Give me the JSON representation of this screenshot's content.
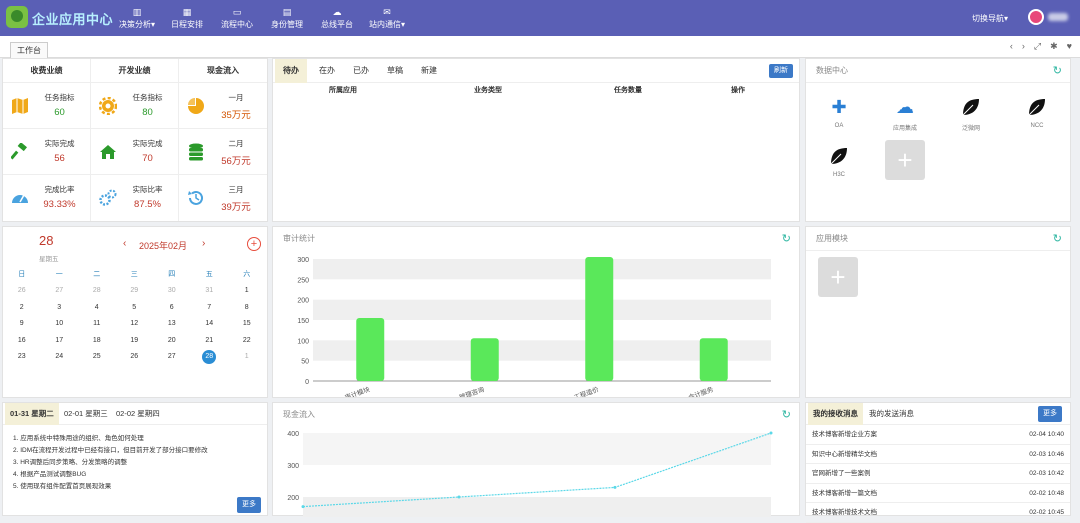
{
  "header": {
    "app_title": "企业应用中心",
    "nav": [
      {
        "label": "决策分析",
        "icon": "bar-chart-icon",
        "dropdown": true
      },
      {
        "label": "日程安排",
        "icon": "calendar-icon",
        "dropdown": false
      },
      {
        "label": "流程中心",
        "icon": "monitor-icon",
        "dropdown": false
      },
      {
        "label": "身份管理",
        "icon": "id-card-icon",
        "dropdown": false
      },
      {
        "label": "总线平台",
        "icon": "cloud-icon",
        "dropdown": false
      },
      {
        "label": "站内通信",
        "icon": "mail-icon",
        "dropdown": true
      }
    ],
    "switch_nav": "切换导航"
  },
  "tabbar": {
    "active_tab": "工作台"
  },
  "stats": {
    "headers": [
      "收费业绩",
      "开发业绩",
      "现金流入"
    ],
    "rows": [
      [
        {
          "label": "任务指标",
          "value": "60",
          "color": "g",
          "icon": "map-icon"
        },
        {
          "label": "任务指标",
          "value": "80",
          "color": "g",
          "icon": "gear-icon"
        },
        {
          "label": "一月",
          "value": "35万元",
          "color": "r",
          "icon": "pie-chart-icon"
        }
      ],
      [
        {
          "label": "实际完成",
          "value": "56",
          "color": "r",
          "icon": "gavel-icon"
        },
        {
          "label": "实际完成",
          "value": "70",
          "color": "r",
          "icon": "home-icon"
        },
        {
          "label": "二月",
          "value": "56万元",
          "color": "r",
          "icon": "database-icon"
        }
      ],
      [
        {
          "label": "完成比率",
          "value": "93.33%",
          "color": "r",
          "icon": "dashboard-icon"
        },
        {
          "label": "实际比率",
          "value": "87.5%",
          "color": "r",
          "icon": "gears-icon"
        },
        {
          "label": "三月",
          "value": "39万元",
          "color": "r",
          "icon": "history-icon"
        }
      ]
    ]
  },
  "todo": {
    "tabs": [
      "待办",
      "在办",
      "已办",
      "草稿",
      "新建"
    ],
    "refresh": "刷新",
    "columns": [
      "所属应用",
      "业务类型",
      "任务数量",
      "操作"
    ]
  },
  "data_center": {
    "title": "数据中心",
    "items": [
      {
        "name": "OA",
        "icon": "puzzle-icon"
      },
      {
        "name": "应用集成",
        "icon": "cloud-icon"
      },
      {
        "name": "泛微网",
        "icon": "leaf-icon"
      },
      {
        "name": "NCC",
        "icon": "leaf-icon"
      },
      {
        "name": "H3C",
        "icon": "leaf-icon"
      }
    ]
  },
  "calendar": {
    "day": "28",
    "weekday": "星期五",
    "month": "2025年02月",
    "weekdays": [
      "日",
      "一",
      "二",
      "三",
      "四",
      "五",
      "六"
    ],
    "days": [
      "26",
      "27",
      "28",
      "29",
      "30",
      "31",
      "1",
      "2",
      "3",
      "4",
      "5",
      "6",
      "7",
      "8",
      "9",
      "10",
      "11",
      "12",
      "13",
      "14",
      "15",
      "16",
      "17",
      "18",
      "19",
      "20",
      "21",
      "22",
      "23",
      "24",
      "25",
      "26",
      "27",
      "28",
      "1"
    ]
  },
  "audit": {
    "title": "审计统计"
  },
  "chart_data": [
    {
      "type": "bar",
      "title": "审计统计",
      "categories": [
        "审计模块",
        "管理咨询",
        "工程造价",
        "会计服务"
      ],
      "values": [
        155,
        105,
        305,
        105
      ],
      "ylim": [
        0,
        300
      ],
      "yticks": [
        0,
        50,
        100,
        150,
        200,
        250,
        300
      ],
      "grid": true,
      "color": "#5ae85a"
    },
    {
      "type": "line",
      "title": "现金流入",
      "ylim": [
        200,
        400
      ],
      "yticks": [
        200,
        300,
        400
      ],
      "series": [
        {
          "values": [
            170,
            200,
            230,
            400
          ]
        }
      ],
      "color": "#5bd8e8"
    }
  ],
  "modules": {
    "title": "应用模块"
  },
  "notes": {
    "tabs": [
      "01-31 星期二",
      "02-01 星期三",
      "02-02 星期四"
    ],
    "items": [
      "1. 应用系统中特殊用途的组织、角色如何处理",
      "2. IDM在流程开发过程中已经有接口，但目前开发了部分接口要修改",
      "3. HR调整后同步策略、分发策略的调整",
      "4. 根据产品测试调整BUG",
      "5. 使用现有组件配置首页展现效果"
    ],
    "more": "更多"
  },
  "cashflow": {
    "title": "现金流入"
  },
  "messages": {
    "tabs": [
      "我的接收消息",
      "我的发送消息"
    ],
    "more": "更多",
    "items": [
      {
        "text": "技术博客新增企业方案",
        "time": "02-04 10:40"
      },
      {
        "text": "知识中心新增精华文档",
        "time": "02-03 10:46"
      },
      {
        "text": "官网新增了一些案例",
        "time": "02-03 10:42"
      },
      {
        "text": "技术博客新增一篇文档",
        "time": "02-02 10:48"
      },
      {
        "text": "技术博客新增技术文档",
        "time": "02-02 10:45"
      }
    ]
  }
}
